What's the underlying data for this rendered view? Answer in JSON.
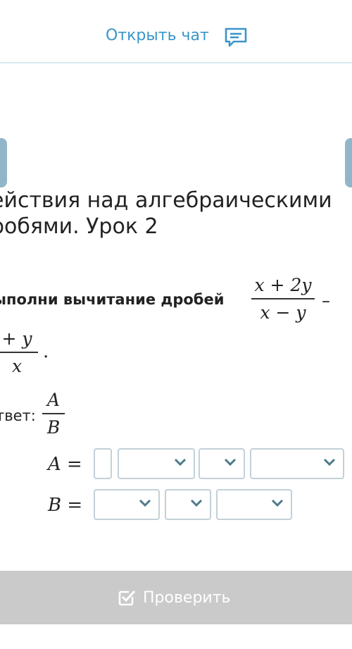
{
  "header": {
    "chat_label": "Открыть чат"
  },
  "lesson": {
    "title": "ействия над алгебраическими\nробями. Урок 2"
  },
  "task": {
    "instruction": "ыполни вычитание дробей",
    "fraction1": {
      "numerator": "x + 2y",
      "denominator": "x − y"
    },
    "operator": "–",
    "fraction2": {
      "numerator": "+ y",
      "denominator": "x"
    },
    "end_mark": "."
  },
  "answer": {
    "label": "твет:",
    "fraction": {
      "numerator": "A",
      "denominator": "B"
    },
    "row_a_label": "A",
    "row_b_label": "B",
    "equals": "="
  },
  "footer": {
    "check_label": "Проверить"
  },
  "colors": {
    "accent": "#3a95c9",
    "input_border": "#c3d1d8",
    "footer_bg": "#cacaca",
    "nav_tab": "#92b6c9"
  }
}
